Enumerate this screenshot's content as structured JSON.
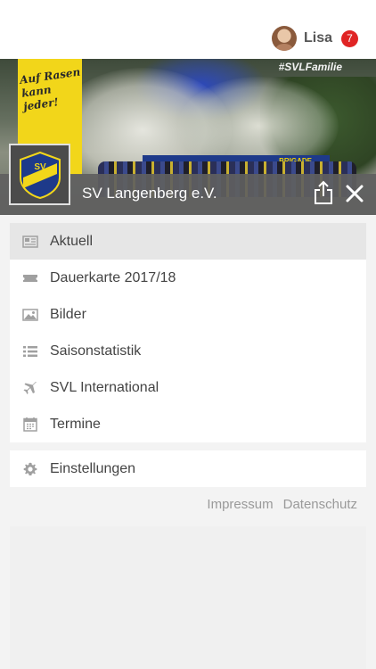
{
  "user": {
    "name": "Lisa",
    "notifications": "7"
  },
  "hero": {
    "sign_text": "Auf Rasen kann jeder!",
    "hashtag": "#SVLFamilie",
    "banner_text": "BRIGADE"
  },
  "club": {
    "name": "SV Langenberg e.V.",
    "logo_text": "SV"
  },
  "menu": [
    {
      "label": "Aktuell",
      "icon": "newspaper-icon",
      "active": true
    },
    {
      "label": "Dauerkarte 2017/18",
      "icon": "ticket-icon"
    },
    {
      "label": "Bilder",
      "icon": "image-icon"
    },
    {
      "label": "Saisonstatistik",
      "icon": "list-icon"
    },
    {
      "label": "SVL International",
      "icon": "plane-icon"
    },
    {
      "label": "Termine",
      "icon": "calendar-icon"
    }
  ],
  "settings": {
    "label": "Einstellungen",
    "icon": "gear-icon"
  },
  "footer": {
    "impressum": "Impressum",
    "datenschutz": "Datenschutz"
  },
  "colors": {
    "badge": "#e02424",
    "club_yellow": "#f2d61a",
    "club_blue": "#1e3a8a",
    "active_row": "#e6e6e6"
  }
}
